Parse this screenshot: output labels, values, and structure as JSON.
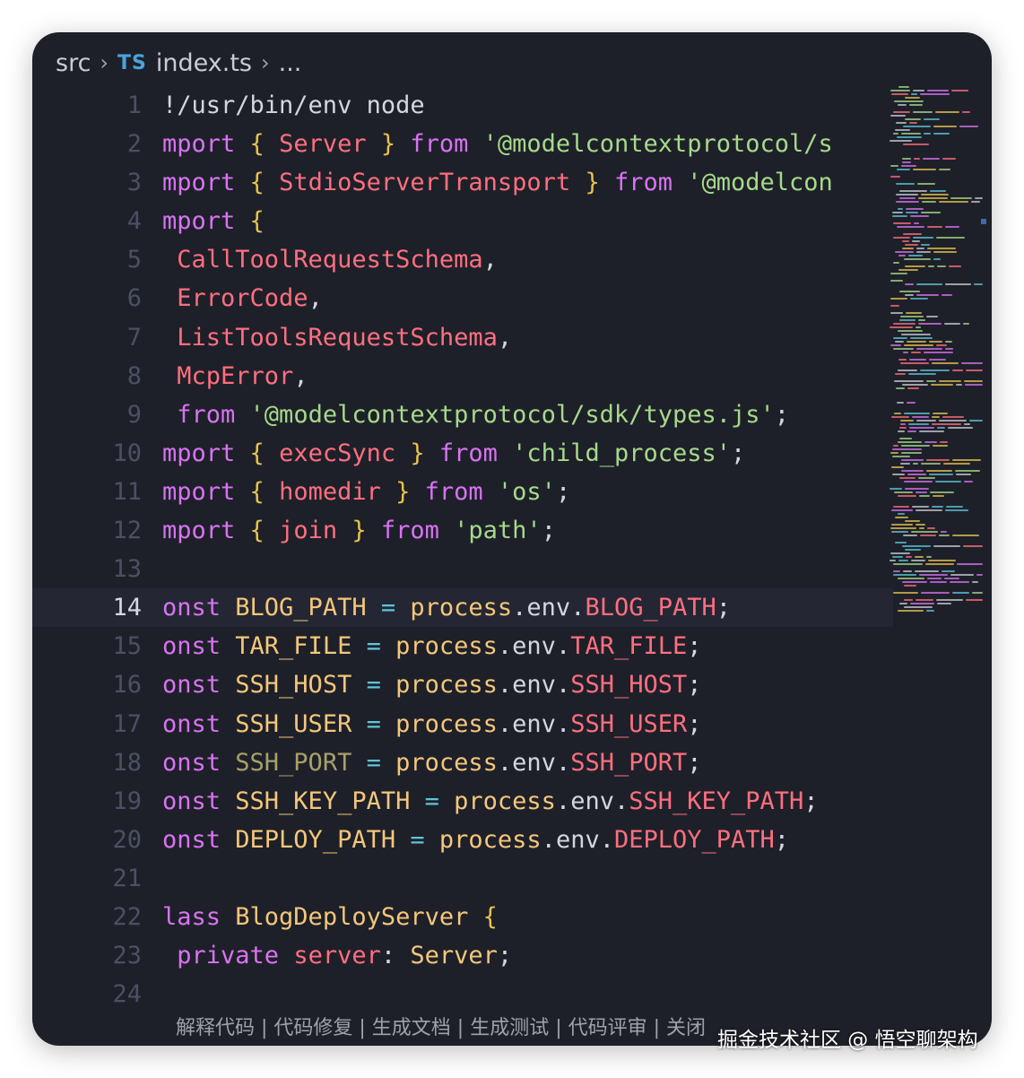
{
  "breadcrumb": {
    "folder": "src",
    "file_icon": "TS",
    "file": "index.ts",
    "more": "..."
  },
  "lines": [
    {
      "n": "1",
      "tokens": [
        {
          "t": "!/usr/bin/env node",
          "c": "pl"
        }
      ]
    },
    {
      "n": "2",
      "tokens": [
        {
          "t": "mport ",
          "c": "kw"
        },
        {
          "t": "{ ",
          "c": "br"
        },
        {
          "t": "Server ",
          "c": "id"
        },
        {
          "t": "} ",
          "c": "br"
        },
        {
          "t": "from ",
          "c": "kw"
        },
        {
          "t": "'@modelcontextprotocol/s",
          "c": "str"
        }
      ]
    },
    {
      "n": "3",
      "tokens": [
        {
          "t": "mport ",
          "c": "kw"
        },
        {
          "t": "{ ",
          "c": "br"
        },
        {
          "t": "StdioServerTransport ",
          "c": "id"
        },
        {
          "t": "} ",
          "c": "br"
        },
        {
          "t": "from ",
          "c": "kw"
        },
        {
          "t": "'@modelcon",
          "c": "str"
        }
      ]
    },
    {
      "n": "4",
      "tokens": [
        {
          "t": "mport ",
          "c": "kw"
        },
        {
          "t": "{",
          "c": "br"
        }
      ]
    },
    {
      "n": "5",
      "tokens": [
        {
          "t": " CallToolRequestSchema",
          "c": "id"
        },
        {
          "t": ",",
          "c": "pl"
        }
      ]
    },
    {
      "n": "6",
      "tokens": [
        {
          "t": " ErrorCode",
          "c": "id"
        },
        {
          "t": ",",
          "c": "pl"
        }
      ]
    },
    {
      "n": "7",
      "tokens": [
        {
          "t": " ListToolsRequestSchema",
          "c": "id"
        },
        {
          "t": ",",
          "c": "pl"
        }
      ]
    },
    {
      "n": "8",
      "tokens": [
        {
          "t": " McpError",
          "c": "id"
        },
        {
          "t": ",",
          "c": "pl"
        }
      ]
    },
    {
      "n": "9",
      "tokens": [
        {
          "t": " from ",
          "c": "kw"
        },
        {
          "t": "'@modelcontextprotocol/sdk/types.js'",
          "c": "str"
        },
        {
          "t": ";",
          "c": "pl"
        }
      ]
    },
    {
      "n": "10",
      "tokens": [
        {
          "t": "mport ",
          "c": "kw"
        },
        {
          "t": "{ ",
          "c": "br"
        },
        {
          "t": "execSync ",
          "c": "id"
        },
        {
          "t": "} ",
          "c": "br"
        },
        {
          "t": "from ",
          "c": "kw"
        },
        {
          "t": "'child_process'",
          "c": "str"
        },
        {
          "t": ";",
          "c": "pl"
        }
      ]
    },
    {
      "n": "11",
      "tokens": [
        {
          "t": "mport ",
          "c": "kw"
        },
        {
          "t": "{ ",
          "c": "br"
        },
        {
          "t": "homedir ",
          "c": "id"
        },
        {
          "t": "} ",
          "c": "br"
        },
        {
          "t": "from ",
          "c": "kw"
        },
        {
          "t": "'os'",
          "c": "str"
        },
        {
          "t": ";",
          "c": "pl"
        }
      ]
    },
    {
      "n": "12",
      "tokens": [
        {
          "t": "mport ",
          "c": "kw"
        },
        {
          "t": "{ ",
          "c": "br"
        },
        {
          "t": "join ",
          "c": "id"
        },
        {
          "t": "} ",
          "c": "br"
        },
        {
          "t": "from ",
          "c": "kw"
        },
        {
          "t": "'path'",
          "c": "str"
        },
        {
          "t": ";",
          "c": "pl"
        }
      ]
    },
    {
      "n": "13",
      "tokens": []
    },
    {
      "n": "14",
      "current": true,
      "tokens": [
        {
          "t": "onst ",
          "c": "kw"
        },
        {
          "t": "BLOG_PATH ",
          "c": "fn"
        },
        {
          "t": "= ",
          "c": "op"
        },
        {
          "t": "process",
          "c": "fn"
        },
        {
          "t": ".",
          "c": "pl"
        },
        {
          "t": "env",
          "c": "pl"
        },
        {
          "t": ".",
          "c": "pl"
        },
        {
          "t": "BLOG_PATH",
          "c": "id"
        },
        {
          "t": ";",
          "c": "pl"
        }
      ]
    },
    {
      "n": "15",
      "tokens": [
        {
          "t": "onst ",
          "c": "kw"
        },
        {
          "t": "TAR_FILE ",
          "c": "fn"
        },
        {
          "t": "= ",
          "c": "op"
        },
        {
          "t": "process",
          "c": "fn"
        },
        {
          "t": ".",
          "c": "pl"
        },
        {
          "t": "env",
          "c": "pl"
        },
        {
          "t": ".",
          "c": "pl"
        },
        {
          "t": "TAR_FILE",
          "c": "id"
        },
        {
          "t": ";",
          "c": "pl"
        }
      ]
    },
    {
      "n": "16",
      "tokens": [
        {
          "t": "onst ",
          "c": "kw"
        },
        {
          "t": "SSH_HOST ",
          "c": "fn"
        },
        {
          "t": "= ",
          "c": "op"
        },
        {
          "t": "process",
          "c": "fn"
        },
        {
          "t": ".",
          "c": "pl"
        },
        {
          "t": "env",
          "c": "pl"
        },
        {
          "t": ".",
          "c": "pl"
        },
        {
          "t": "SSH_HOST",
          "c": "id"
        },
        {
          "t": ";",
          "c": "pl"
        }
      ]
    },
    {
      "n": "17",
      "tokens": [
        {
          "t": "onst ",
          "c": "kw"
        },
        {
          "t": "SSH_USER ",
          "c": "fn"
        },
        {
          "t": "= ",
          "c": "op"
        },
        {
          "t": "process",
          "c": "fn"
        },
        {
          "t": ".",
          "c": "pl"
        },
        {
          "t": "env",
          "c": "pl"
        },
        {
          "t": ".",
          "c": "pl"
        },
        {
          "t": "SSH_USER",
          "c": "id"
        },
        {
          "t": ";",
          "c": "pl"
        }
      ]
    },
    {
      "n": "18",
      "tokens": [
        {
          "t": "onst ",
          "c": "kw"
        },
        {
          "t": "SSH_PORT ",
          "c": "dim"
        },
        {
          "t": "= ",
          "c": "op"
        },
        {
          "t": "process",
          "c": "fn"
        },
        {
          "t": ".",
          "c": "pl"
        },
        {
          "t": "env",
          "c": "pl"
        },
        {
          "t": ".",
          "c": "pl"
        },
        {
          "t": "SSH_PORT",
          "c": "id"
        },
        {
          "t": ";",
          "c": "pl"
        }
      ]
    },
    {
      "n": "19",
      "tokens": [
        {
          "t": "onst ",
          "c": "kw"
        },
        {
          "t": "SSH_KEY_PATH ",
          "c": "fn"
        },
        {
          "t": "= ",
          "c": "op"
        },
        {
          "t": "process",
          "c": "fn"
        },
        {
          "t": ".",
          "c": "pl"
        },
        {
          "t": "env",
          "c": "pl"
        },
        {
          "t": ".",
          "c": "pl"
        },
        {
          "t": "SSH_KEY_PATH",
          "c": "id"
        },
        {
          "t": ";",
          "c": "pl"
        }
      ]
    },
    {
      "n": "20",
      "tokens": [
        {
          "t": "onst ",
          "c": "kw"
        },
        {
          "t": "DEPLOY_PATH ",
          "c": "fn"
        },
        {
          "t": "= ",
          "c": "op"
        },
        {
          "t": "process",
          "c": "fn"
        },
        {
          "t": ".",
          "c": "pl"
        },
        {
          "t": "env",
          "c": "pl"
        },
        {
          "t": ".",
          "c": "pl"
        },
        {
          "t": "DEPLOY_PATH",
          "c": "id"
        },
        {
          "t": ";",
          "c": "pl"
        }
      ]
    },
    {
      "n": "21",
      "tokens": []
    },
    {
      "n": "22",
      "tokens": [
        {
          "t": "lass ",
          "c": "kw"
        },
        {
          "t": "BlogDeployServer ",
          "c": "fn"
        },
        {
          "t": "{",
          "c": "br"
        }
      ]
    },
    {
      "n": "23",
      "tokens": [
        {
          "t": " private ",
          "c": "kw"
        },
        {
          "t": "server",
          "c": "id"
        },
        {
          "t": ": ",
          "c": "pl"
        },
        {
          "t": "Server",
          "c": "fn"
        },
        {
          "t": ";",
          "c": "pl"
        }
      ]
    },
    {
      "n": "24",
      "tokens": []
    }
  ],
  "bottom_bar": "解释代码 | 代码修复 | 生成文档 | 生成测试 | 代码评审 | 关闭",
  "watermark": "掘金技术社区 @ 悟空聊架构",
  "colors": {
    "background": "#1e2029",
    "keyword": "#d873f2",
    "identifier": "#ff6f7f",
    "string": "#a6da8a",
    "bracket": "#e8c34d",
    "operator": "#5ec5d8",
    "type": "#f4c77a"
  }
}
